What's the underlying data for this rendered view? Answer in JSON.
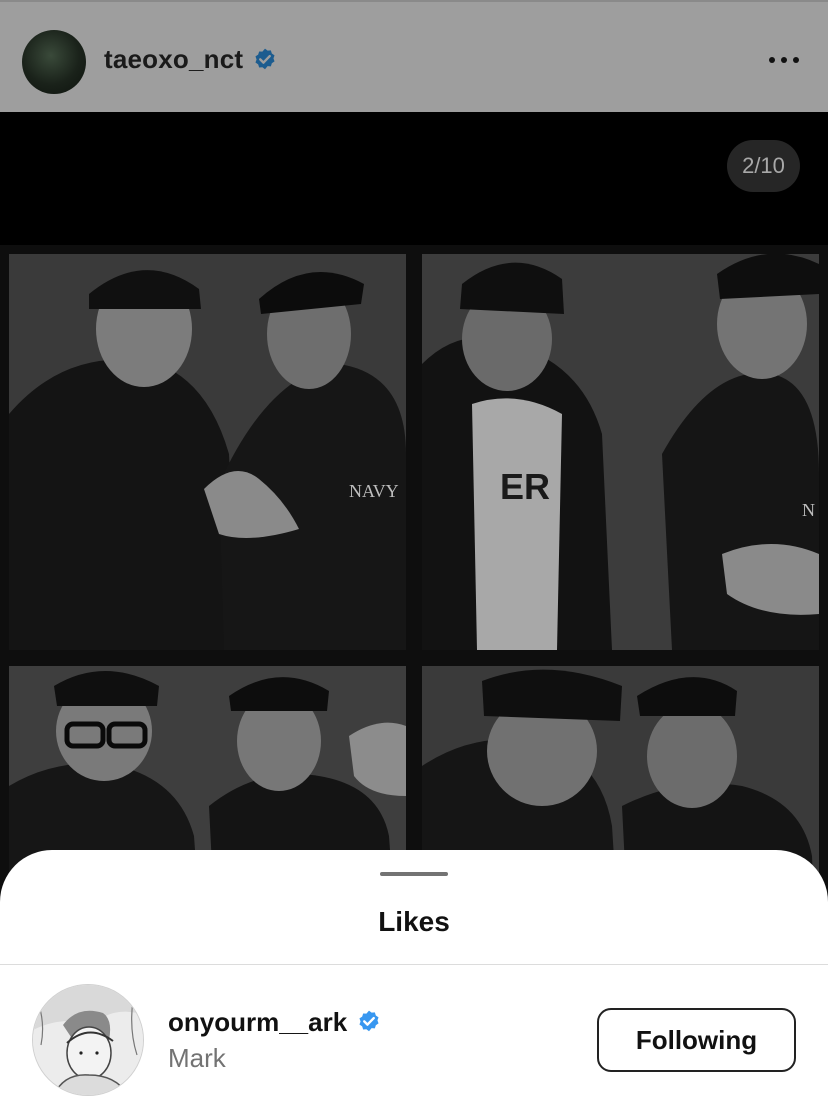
{
  "post": {
    "username": "taeoxo_nct",
    "verified": true,
    "more_icon": "more-horizontal-icon",
    "carousel_counter": "2/10",
    "photo_text": {
      "shirt_label_1": "NAVY",
      "shirt_label_2": "ER",
      "shirt_label_3": "N"
    }
  },
  "likes_sheet": {
    "title": "Likes",
    "users": [
      {
        "username": "onyourm__ark",
        "full_name": "Mark",
        "verified": true,
        "button_label": "Following"
      }
    ]
  },
  "colors": {
    "verified_blue": "#0095f6",
    "dim_overlay": "#9e9e9e",
    "sheet_bg": "#ffffff",
    "secondary_text": "#737373"
  }
}
